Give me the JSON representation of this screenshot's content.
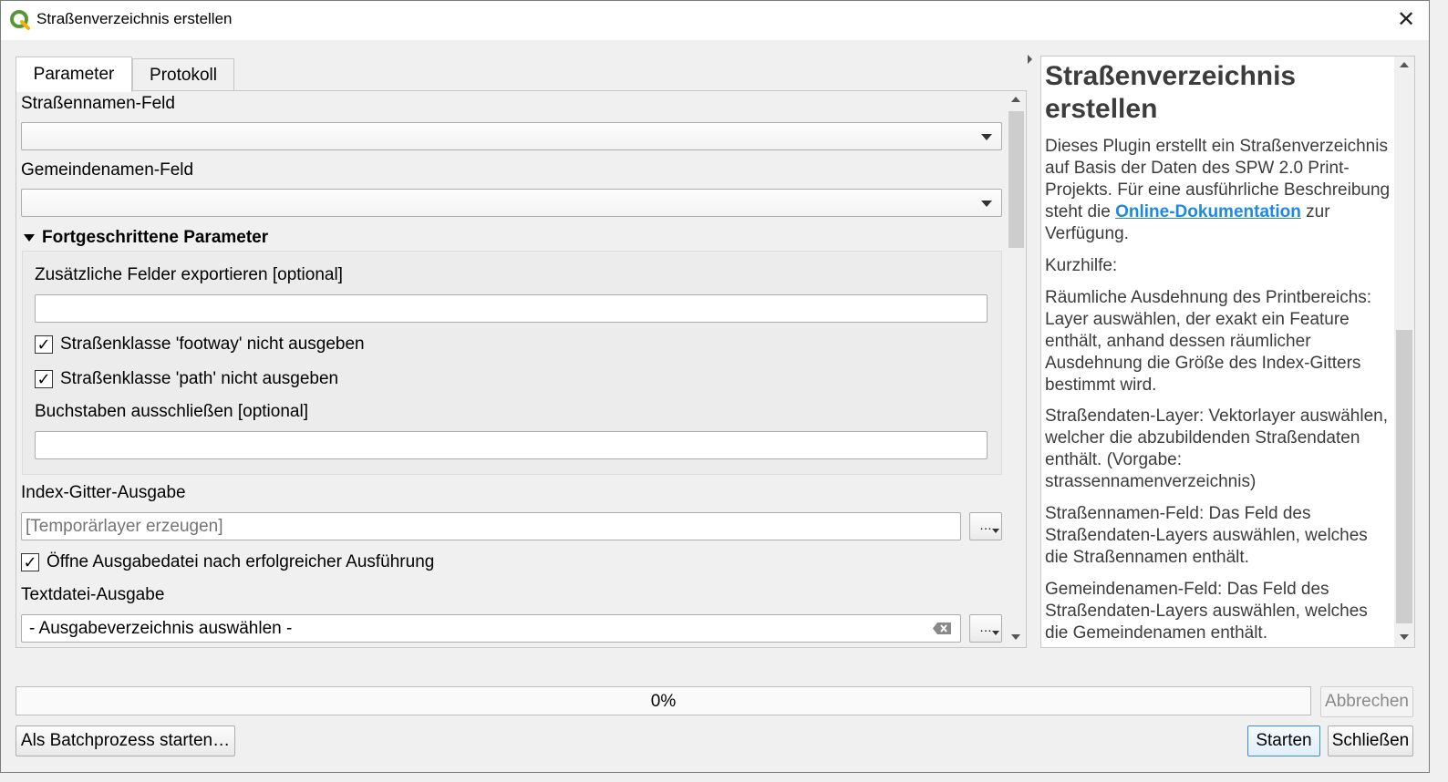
{
  "window": {
    "title": "Straßenverzeichnis erstellen",
    "close_glyph": "✕"
  },
  "tabs": [
    {
      "label": "Parameter",
      "active": true
    },
    {
      "label": "Protokoll",
      "active": false
    }
  ],
  "params": {
    "street_field_label": "Straßennamen-Feld",
    "street_field_value": "",
    "municipality_field_label": "Gemeindenamen-Feld",
    "municipality_field_value": "",
    "advanced_label": "Fortgeschrittene Parameter",
    "extra_fields_label": "Zusätzliche Felder exportieren [optional]",
    "extra_fields_value": "",
    "footway_label": "Straßenklasse 'footway' nicht ausgeben",
    "footway_checked": true,
    "path_label": "Straßenklasse 'path' nicht ausgeben",
    "path_checked": true,
    "exclude_letters_label": "Buchstaben ausschließen [optional]",
    "exclude_letters_value": "",
    "grid_output_label": "Index-Gitter-Ausgabe",
    "grid_output_placeholder": "[Temporärlayer erzeugen]",
    "open_output_label": "Öffne Ausgabedatei nach erfolgreicher Ausführung",
    "open_output_checked": true,
    "text_output_label": "Textdatei-Ausgabe",
    "text_output_value": "- Ausgabeverzeichnis auswählen -",
    "browse_label": "…",
    "check_glyph": "✓"
  },
  "help": {
    "title": "Straßenverzeichnis erstellen",
    "intro_before": "Dieses Plugin erstellt ein Straßenverzeichnis auf Basis der Daten des SPW 2.0 Print-Projekts. Für eine ausführliche Beschreibung steht die ",
    "link_text": "Online-Dokumentation",
    "intro_after": " zur Verfügung.",
    "kurzhilfe": "Kurzhilfe:",
    "p1": "Räumliche Ausdehnung des Printbereichs: Layer auswählen, der exakt ein Feature enthält, anhand dessen räumlicher Ausdehnung die Größe des Index-Gitters bestimmt wird.",
    "p2": "Straßendaten-Layer: Vektorlayer auswählen, welcher die abzubildenden Straßendaten enthält. (Vorgabe: strassennamenverzeichnis)",
    "p3": "Straßennamen-Feld: Das Feld des Straßendaten-Layers auswählen, welches die Straßennamen enthält.",
    "p4": "Gemeindenamen-Feld: Das Feld des Straßendaten-Layers auswählen, welches die Gemeindenamen enthält."
  },
  "progress": {
    "percent": 0,
    "text": "0%"
  },
  "buttons": {
    "cancel": "Abbrechen",
    "batch": "Als Batchprozess starten…",
    "start": "Starten",
    "close": "Schließen"
  },
  "colors": {
    "link": "#1e88e5",
    "qgis_green": "#589632",
    "qgis_yellow": "#f0b400"
  }
}
